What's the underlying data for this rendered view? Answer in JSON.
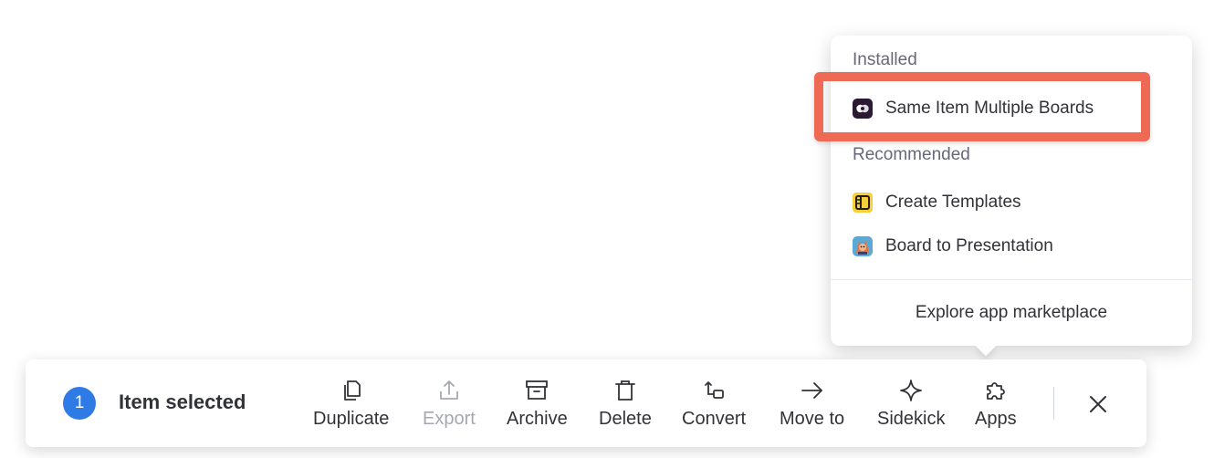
{
  "apps_menu": {
    "installed_title": "Installed",
    "installed_items": [
      {
        "label": "Same Item Multiple Boards",
        "icon": "same-item-multiple-boards-icon"
      }
    ],
    "recommended_title": "Recommended",
    "recommended_items": [
      {
        "label": "Create Templates",
        "icon": "create-templates-icon"
      },
      {
        "label": "Board to Presentation",
        "icon": "board-to-presentation-icon"
      }
    ],
    "explore_label": "Explore app marketplace"
  },
  "action_bar": {
    "selected_count": "1",
    "selected_label": "Item selected",
    "actions": [
      {
        "label": "Duplicate",
        "icon": "duplicate-icon",
        "enabled": true
      },
      {
        "label": "Export",
        "icon": "export-icon",
        "enabled": false
      },
      {
        "label": "Archive",
        "icon": "archive-icon",
        "enabled": true
      },
      {
        "label": "Delete",
        "icon": "trash-icon",
        "enabled": true
      },
      {
        "label": "Convert",
        "icon": "convert-icon",
        "enabled": true
      },
      {
        "label": "Move to",
        "icon": "arrow-right-icon",
        "enabled": true
      },
      {
        "label": "Sidekick",
        "icon": "sparkle-icon",
        "enabled": true
      },
      {
        "label": "Apps",
        "icon": "puzzle-icon",
        "enabled": true
      }
    ],
    "close_icon": "close-icon"
  },
  "colors": {
    "accent": "#2f7be6",
    "highlight": "#ee6a55",
    "text": "#323338",
    "muted": "#676879",
    "disabled": "#a5a7b3"
  }
}
